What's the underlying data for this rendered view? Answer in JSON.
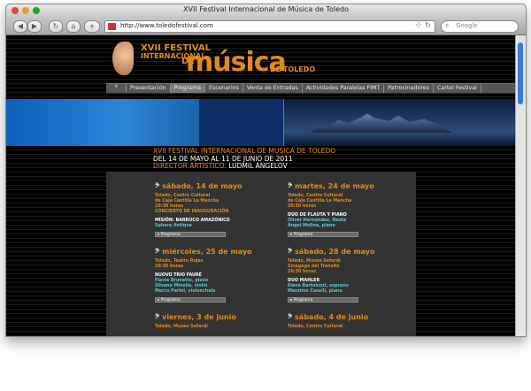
{
  "browser": {
    "title": "XVII Festival Internacional de Música de Toledo",
    "url": "http://www.toledofestival.com",
    "search_placeholder": "Google"
  },
  "site": {
    "logo": {
      "line1": "XVII FESTIVAL",
      "line2": "INTERNACIONAL",
      "de": "DE",
      "musica": "música",
      "toledo": "DE TOLEDO"
    },
    "nav": [
      {
        "label": "Presentación"
      },
      {
        "label": "Programa"
      },
      {
        "label": "Escenarios"
      },
      {
        "label": "Venta de Entradas"
      },
      {
        "label": "Actividades Paralelas FIMT"
      },
      {
        "label": "Patrocinadores"
      },
      {
        "label": "Cartel Festival"
      }
    ],
    "heading": {
      "line1": "XVII FESTIVAL INTERNACIONAL DE MÚSICA DE TOLEDO",
      "line2": "DEL 14 DE MAYO AL 11 DE JUNIO DE 2011",
      "line3_prefix": "DIRECTOR ARTÍSTICO: ",
      "line3_name": "LUDMIL ANGELOV"
    },
    "program_label": "Programa",
    "events_left": [
      {
        "date": "sábado, 14 de mayo",
        "venue": [
          "Toledo, Centro Cultural",
          "de Caja Castilla La Mancha",
          "20:30 horas",
          "CONCIERTO DE INAUGURACIÓN"
        ],
        "work": "MISIÓN: BARROCO AMAZÓNICO",
        "performers": [
          "Sphera Antiqva"
        ]
      },
      {
        "date": "miércoles, 25 de mayo",
        "venue": [
          "Toledo, Teatro Rojas",
          "20:30 horas"
        ],
        "work": "NUOVO TRIO FAURÉ",
        "performers": [
          "Flavia Brunetto, piano",
          "Silvano Minella, violín",
          "Marco Perini, violonchelo"
        ]
      },
      {
        "date": "viernes, 3 de junio",
        "venue": [
          "Toledo, Museo Sefardí"
        ],
        "work": "",
        "performers": []
      }
    ],
    "events_right": [
      {
        "date": "martes, 24 de mayo",
        "venue": [
          "Toledo, Centro Cultural",
          "de Caja Castilla La Mancha",
          "20:30 horas"
        ],
        "work": "DÚO DE FLAUTA Y PIANO",
        "performers": [
          "Oliver Hernández, flauta",
          "Ángel Molina, piano"
        ]
      },
      {
        "date": "sábado, 28 de mayo",
        "venue": [
          "Toledo, Museo Sefardí",
          "Sinagoga del Tránsito",
          "20:30 horas"
        ],
        "work": "DUO MAHLER",
        "performers": [
          "Elena Bartolozzi, soprano",
          "Massimo Caselli, piano"
        ]
      },
      {
        "date": "sábado, 4 de junio",
        "venue": [
          "Toledo, Centro Cultural"
        ],
        "work": "",
        "performers": []
      }
    ]
  }
}
